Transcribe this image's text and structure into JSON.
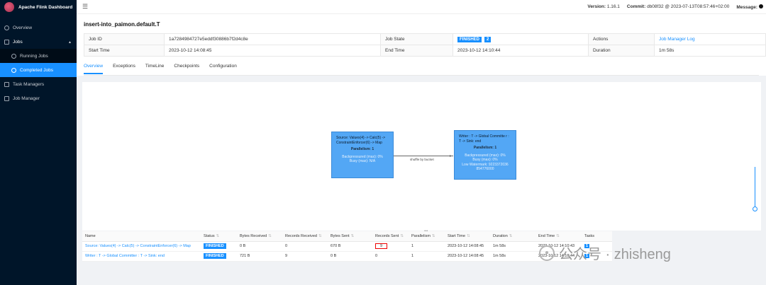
{
  "app": {
    "title": "Apache Flink Dashboard"
  },
  "sidebar": {
    "items": [
      {
        "label": "Overview"
      },
      {
        "label": "Jobs"
      },
      {
        "label": "Running Jobs"
      },
      {
        "label": "Completed Jobs"
      },
      {
        "label": "Task Managers"
      },
      {
        "label": "Job Manager"
      }
    ]
  },
  "topbar": {
    "version_label": "Version:",
    "version": "1.16.1",
    "commit_label": "Commit:",
    "commit": "db08f32 @ 2023-07-13T08:57:46+02:00",
    "message_label": "Message:"
  },
  "job": {
    "name": "insert-into_paimon.default.T",
    "job_id_label": "Job ID",
    "job_id": "1a7284984727e5eddf30886b7f2d4c8e",
    "state_label": "Job State",
    "state": "FINISHED",
    "state_count": "2",
    "actions_label": "Actions",
    "action_link": "Job Manager Log",
    "start_label": "Start Time",
    "start": "2023-10-12 14:08:45",
    "end_label": "End Time",
    "end": "2023-10-12 14:10:44",
    "duration_label": "Duration",
    "duration": "1m 58s"
  },
  "tabs": [
    {
      "label": "Overview"
    },
    {
      "label": "Exceptions"
    },
    {
      "label": "TimeLine"
    },
    {
      "label": "Checkpoints"
    },
    {
      "label": "Configuration"
    }
  ],
  "graph": {
    "source": {
      "title": "Source: Values(4) -> Calc(5) -> ConstraintEnforcer(6) -> Map",
      "parallelism": "Parallelism: 1",
      "backpressured": "Backpressured (max): 0%",
      "busy": "Busy (max): N/A"
    },
    "edge_label": "shuffle by bucket",
    "sink": {
      "title": "Writer : T -> Global Committe r : T -> Sink: end",
      "parallelism": "Parallelism: 1",
      "backpressured": "Backpressured (max): 0%",
      "busy": "Busy (max): 0%",
      "watermark": "Low Watermark: 9223372036 854776000"
    }
  },
  "vertex_table": {
    "headers": [
      "Name",
      "Status",
      "Bytes Received",
      "Records Received",
      "Bytes Sent",
      "Records Sent",
      "Parallelism",
      "Start Time",
      "Duration",
      "End Time",
      "Tasks"
    ],
    "rows": [
      {
        "name": "Source: Values(4) -> Calc(5) -> ConstraintEnforcer(6) -> Map",
        "status": "FINISHED",
        "bytes_received": "0 B",
        "records_received": "0",
        "bytes_sent": "670 B",
        "records_sent": "9",
        "parallelism": "1",
        "start": "2023-10-12 14:08:45",
        "duration": "1m 58s",
        "end": "2023-10-12 14:10:43",
        "tasks": "1"
      },
      {
        "name": "Writer : T -> Global Committer : T -> Sink: end",
        "status": "FINISHED",
        "bytes_received": "721 B",
        "records_received": "9",
        "bytes_sent": "0 B",
        "records_sent": "0",
        "parallelism": "1",
        "start": "2023-10-12 14:08:45",
        "duration": "1m 58s",
        "end": "2023-10-12 14:10:44",
        "tasks": "1"
      }
    ]
  },
  "watermark_text": "公众号 · zhisheng"
}
